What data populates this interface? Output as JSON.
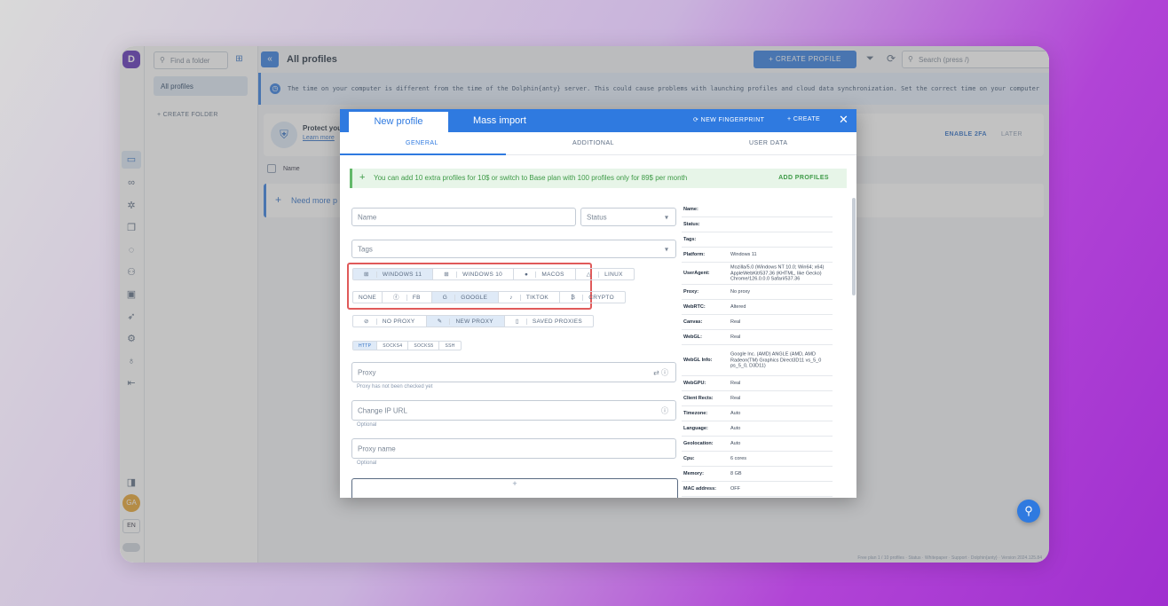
{
  "app": {
    "logo": "D",
    "title": "All profiles",
    "create_profile": "+ CREATE PROFILE",
    "search_placeholder": "Search (press /)",
    "avatar": "GA",
    "lang": "EN"
  },
  "folders": {
    "search_placeholder": "Find a folder",
    "all": "All profiles",
    "create": "+ CREATE FOLDER"
  },
  "warning": "The time on your computer is different from the time of the Dolphin{anty} server. This could cause problems with launching profiles and cloud data synchronization. Set the correct time on your computer",
  "protect": {
    "title": "Protect you",
    "learn_more": "Learn more",
    "enable": "ENABLE 2FA",
    "later": "LATER"
  },
  "table": {
    "name_col": "Name"
  },
  "need_more": "Need more p",
  "footer": "Free plan 1 / 10 profiles · Status · Whitepaper · Support · Dolphin{anty} · Version 2024.125.84",
  "modal": {
    "tab_new": "New profile",
    "tab_import": "Mass import",
    "new_fingerprint": "⟳ NEW FINGERPRINT",
    "create": "+ CREATE",
    "close": "✕",
    "subtabs": [
      "GENERAL",
      "ADDITIONAL",
      "USER DATA"
    ],
    "promo": "You can add 10 extra profiles for 10$ or switch to Base plan with 100 profiles only for 89$ per month",
    "add_profiles": "ADD PROFILES",
    "name_placeholder": "Name",
    "status_placeholder": "Status",
    "tags_placeholder": "Tags",
    "platforms": [
      "WINDOWS 11",
      "WINDOWS 10",
      "MACOS",
      "LINUX"
    ],
    "templates": [
      "NONE",
      "FB",
      "GOOGLE",
      "TIKTOK",
      "CRYPTO"
    ],
    "proxy_modes": [
      "NO PROXY",
      "NEW PROXY",
      "SAVED PROXIES"
    ],
    "protocols": [
      "HTTP",
      "SOCKS4",
      "SOCKS5",
      "SSH"
    ],
    "proxy_placeholder": "Proxy",
    "proxy_help": "Proxy has not been checked yet",
    "change_ip_placeholder": "Change IP URL",
    "change_ip_help": "Optional",
    "proxy_name_placeholder": "Proxy name",
    "proxy_name_help": "Optional"
  },
  "summary": [
    {
      "k": "Name:",
      "v": ""
    },
    {
      "k": "Status:",
      "v": ""
    },
    {
      "k": "Tags:",
      "v": ""
    },
    {
      "k": "Platform:",
      "v": "Windows 11"
    },
    {
      "k": "UserAgent:",
      "v": "Mozilla/5.0 (Windows NT 10.0; Win64; x64) AppleWebKit/537.36 (KHTML, like Gecko) Chrome/126.0.0.0 Safari/537.36"
    },
    {
      "k": "Proxy:",
      "v": "No proxy"
    },
    {
      "k": "WebRTC:",
      "v": "Altered"
    },
    {
      "k": "Canvas:",
      "v": "Real"
    },
    {
      "k": "WebGL:",
      "v": "Real"
    },
    {
      "k": "WebGL Info:",
      "v": "Google Inc. (AMD) ANGLE (AMD, AMD Radeon(TM) Graphics Direct3D11 vs_5_0 ps_5_0, D3D11)"
    },
    {
      "k": "WebGPU:",
      "v": "Real"
    },
    {
      "k": "Client Rects:",
      "v": "Real"
    },
    {
      "k": "Timezone:",
      "v": "Auto"
    },
    {
      "k": "Language:",
      "v": "Auto"
    },
    {
      "k": "Geolocation:",
      "v": "Auto"
    },
    {
      "k": "Cpu:",
      "v": "6 cores"
    },
    {
      "k": "Memory:",
      "v": "8 GB"
    },
    {
      "k": "MAC address:",
      "v": "OFF"
    }
  ]
}
